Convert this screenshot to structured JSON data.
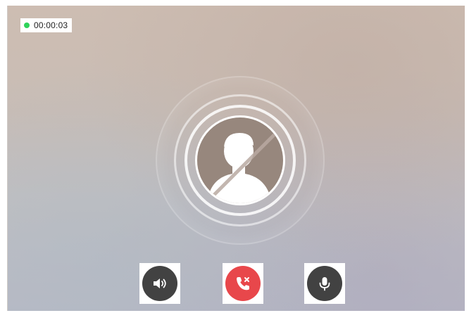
{
  "call": {
    "status": "connected",
    "duration": "00:00:03",
    "status_color": "#2fd35a"
  },
  "avatar": {
    "icon": "person-silhouette-icon",
    "state": "video-off"
  },
  "controls": [
    {
      "name": "speaker",
      "icon": "speaker-icon",
      "color": "#424242"
    },
    {
      "name": "hang-up",
      "icon": "phone-hangup-icon",
      "color": "#e8474b"
    },
    {
      "name": "microphone",
      "icon": "microphone-icon",
      "color": "#424242"
    }
  ]
}
